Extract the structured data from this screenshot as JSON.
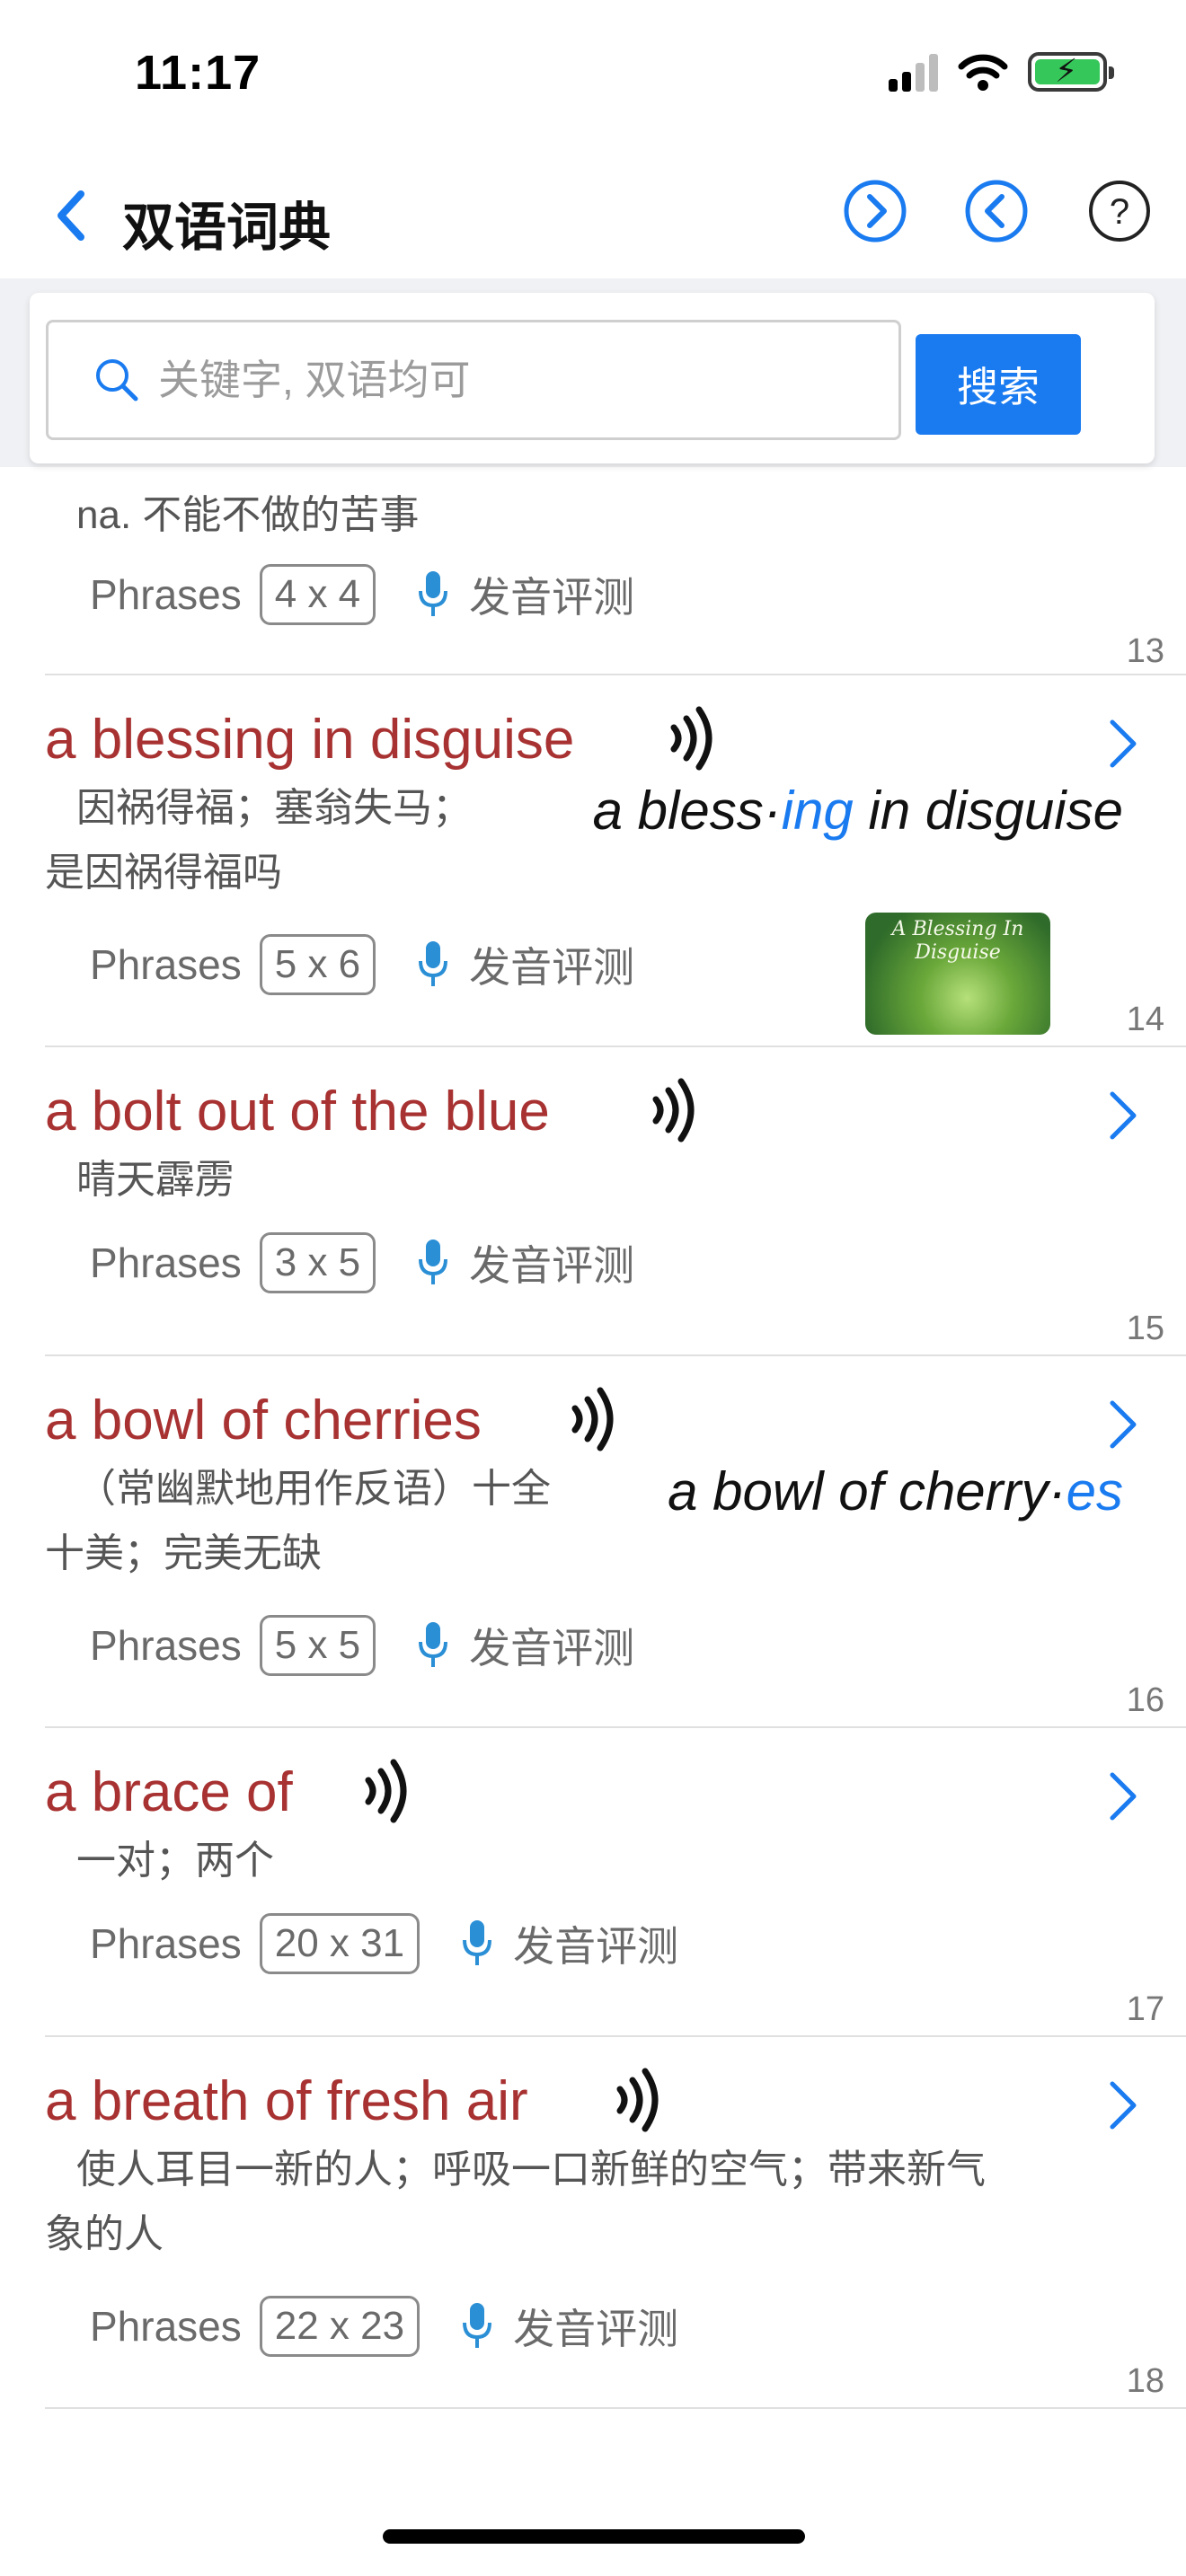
{
  "status_bar": {
    "time": "11:17"
  },
  "nav": {
    "title": "双语词典",
    "back_icon": "chevron-left-icon",
    "next_icon": "circle-chevron-right-icon",
    "prev_icon": "circle-chevron-left-icon",
    "help_icon": "help-circle-icon"
  },
  "search": {
    "placeholder": "关键字, 双语均可",
    "value": "",
    "button_label": "搜索"
  },
  "colors": {
    "accent": "#1a7bf0",
    "title_red": "#a83232"
  },
  "entries": [
    {
      "title": "",
      "meaning": "na.  不能不做的苦事",
      "category": "Phrases",
      "size": "4 x 4",
      "eval_label": "发音评测",
      "number": "13"
    },
    {
      "title": "a blessing in disguise",
      "meaning": "因祸得福；塞翁失马；",
      "meaning2": "是因祸得福吗",
      "hyph_a": "a bless·",
      "hyph_hl": "ing",
      "hyph_b": " in disguise",
      "thumb_caption": "A Blessing In Disguise",
      "category": "Phrases",
      "size": "5 x 6",
      "eval_label": "发音评测",
      "number": "14"
    },
    {
      "title": "a bolt out of the blue",
      "meaning": "晴天霹雳",
      "category": "Phrases",
      "size": "3 x 5",
      "eval_label": "发音评测",
      "number": "15"
    },
    {
      "title": "a bowl of cherries",
      "meaning": "（常幽默地用作反语）十全",
      "meaning2": "十美；完美无缺",
      "hyph_a": "a bowl of cherry·",
      "hyph_hl": "es",
      "hyph_b": "",
      "category": "Phrases",
      "size": "5 x 5",
      "eval_label": "发音评测",
      "number": "16"
    },
    {
      "title": "a brace of",
      "meaning": "一对；两个",
      "category": "Phrases",
      "size": "20 x 31",
      "eval_label": "发音评测",
      "number": "17"
    },
    {
      "title": "a breath of fresh air",
      "meaning": "使人耳目一新的人；呼吸一口新鲜的空气；带来新气",
      "meaning2": "象的人",
      "category": "Phrases",
      "size": "22 x 23",
      "eval_label": "发音评测",
      "number": "18"
    }
  ]
}
